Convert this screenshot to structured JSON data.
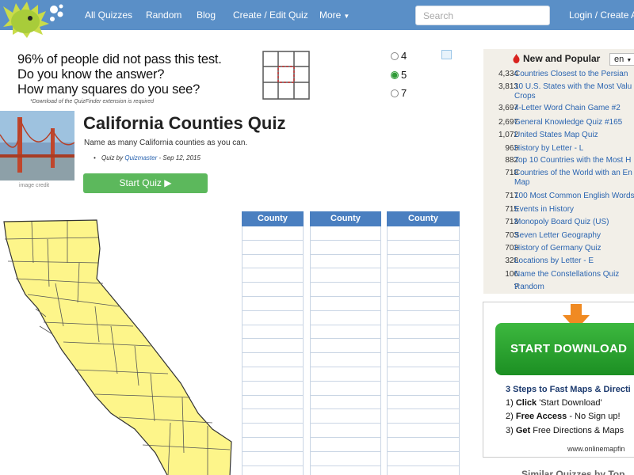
{
  "nav": {
    "links": [
      "All Quizzes",
      "Random",
      "Blog",
      "Create / Edit Quiz",
      "More"
    ],
    "search_placeholder": "Search",
    "login": "Login / Create A"
  },
  "ad": {
    "lines": [
      "96% of people did not pass this test.",
      "Do you know the answer?",
      "How many squares do you see?"
    ],
    "note": "*Download of the QuizFinder extension is required",
    "options": [
      "4",
      "5",
      "7"
    ],
    "selected_option": "5"
  },
  "quiz": {
    "title": "California Counties Quiz",
    "description": "Name as many California counties as you can.",
    "meta_prefix": "Quiz by ",
    "author": "Quizmaster",
    "date": " - Sep 12, 2015",
    "start_label": "Start Quiz ▶",
    "image_credit": "image credit",
    "columns": [
      "County",
      "County",
      "County"
    ]
  },
  "sidebar": {
    "title": "New and Popular",
    "language": "en",
    "items": [
      {
        "count": "4,334",
        "title": "Countries Closest to the Persian"
      },
      {
        "count": "3,813",
        "title": "10 U.S. States with the Most Valu Crops"
      },
      {
        "count": "3,697",
        "title": "4-Letter Word Chain Game #2"
      },
      {
        "count": "2,697",
        "title": "General Knowledge Quiz #165"
      },
      {
        "count": "1,072",
        "title": "United States Map Quiz"
      },
      {
        "count": "963",
        "title": "History by Letter - L"
      },
      {
        "count": "882",
        "title": "Top 10 Countries with the Most H"
      },
      {
        "count": "718",
        "title": "Countries of the World with an En Map"
      },
      {
        "count": "717",
        "title": "100 Most Common English Words"
      },
      {
        "count": "715",
        "title": "Events in History"
      },
      {
        "count": "713",
        "title": "Monopoly Board Quiz (US)"
      },
      {
        "count": "703",
        "title": "Seven Letter Geography"
      },
      {
        "count": "703",
        "title": "History of Germany Quiz"
      },
      {
        "count": "328",
        "title": "Locations by Letter - E"
      },
      {
        "count": "106",
        "title": "Name the Constellations Quiz"
      },
      {
        "count": "?",
        "title": "Random"
      }
    ]
  },
  "download_ad": {
    "button_label": "START DOWNLOAD",
    "steps_title": "3 Steps to Fast Maps & Directi",
    "steps": [
      {
        "prefix": "1) ",
        "bold": "Click",
        "rest": " 'Start Download'"
      },
      {
        "prefix": "2) ",
        "bold": "Free Access",
        "rest": " - No Sign up!"
      },
      {
        "prefix": "3) ",
        "bold": "Get",
        "rest": " Free Directions & Maps"
      }
    ],
    "url": "www.onlinemapfin"
  },
  "similar_title": "Similar Quizzes by Top"
}
